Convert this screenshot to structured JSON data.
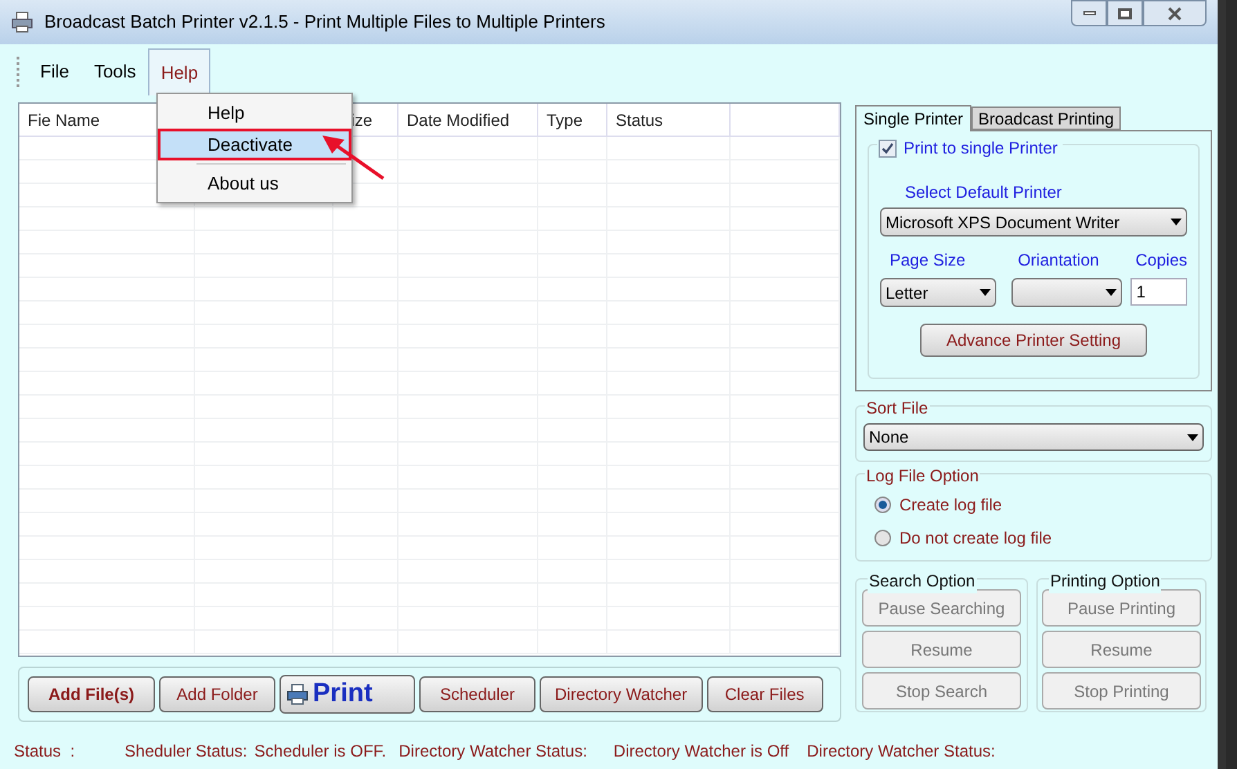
{
  "window": {
    "title": "Broadcast Batch Printer v2.1.5 - Print Multiple Files to Multiple Printers"
  },
  "menu": [
    {
      "label": "File",
      "selected": false
    },
    {
      "label": "Tools",
      "selected": false
    },
    {
      "label": "Help",
      "selected": true
    }
  ],
  "help_menu": {
    "items": [
      {
        "kind": "item",
        "label": "Help",
        "highlighted": false
      },
      {
        "kind": "item",
        "label": "Deactivate",
        "highlighted": true
      },
      {
        "kind": "separator"
      },
      {
        "kind": "item",
        "label": "About us",
        "highlighted": false
      }
    ]
  },
  "table": {
    "columns": [
      "Fie Name",
      "",
      "ize",
      "Date Modified",
      "Type",
      "Status",
      ""
    ]
  },
  "tabs": [
    {
      "label": "Single Printer",
      "selected": true
    },
    {
      "label": "Broadcast Printing",
      "selected": false
    }
  ],
  "single_printer": {
    "checkbox": {
      "label": "Print to single Printer",
      "checked": true
    },
    "printer_label": "Select Default Printer",
    "printer": "Microsoft XPS Document Writer",
    "page_size_label": "Page Size",
    "page_size": "Letter",
    "orientation_label": "Oriantation",
    "copies_label": "Copies",
    "copies": "1",
    "advance_button": "Advance Printer Setting"
  },
  "sort_file": {
    "label": "Sort File",
    "value": "None"
  },
  "log_file_option": {
    "label": "Log File Option",
    "options": [
      {
        "label": "Create log file",
        "selected": true
      },
      {
        "label": "Do not create log file",
        "selected": false
      }
    ]
  },
  "search_option": {
    "label": "Search Option",
    "buttons": [
      {
        "label": "Pause Searching",
        "disabled": true
      },
      {
        "label": "Resume",
        "disabled": true
      },
      {
        "label": "Stop Search",
        "disabled": true
      }
    ]
  },
  "printing_option": {
    "label": "Printing Option",
    "buttons": [
      {
        "label": "Pause Printing",
        "disabled": true
      },
      {
        "label": "Resume",
        "disabled": true
      },
      {
        "label": "Stop Printing",
        "disabled": true
      }
    ]
  },
  "buttons": [
    {
      "label": "Add File(s)",
      "kind": "bold"
    },
    {
      "label": "Add Folder",
      "kind": "normal"
    },
    {
      "label": "Print",
      "kind": "print"
    },
    {
      "label": "Scheduler",
      "kind": "normal"
    },
    {
      "label": "Directory Watcher",
      "kind": "normal"
    },
    {
      "label": "Clear Files",
      "kind": "normal"
    }
  ],
  "status_bar": [
    "Status  :",
    "Sheduler Status:",
    "Scheduler is OFF.",
    "Directory Watcher Status:",
    "Directory Watcher is Off",
    "Directory Watcher Status:"
  ]
}
